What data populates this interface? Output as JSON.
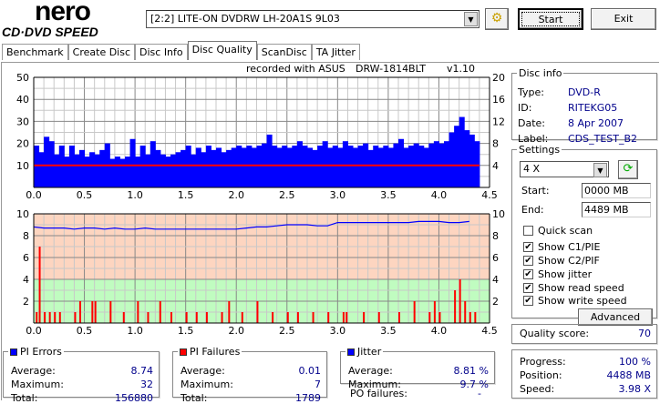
{
  "app": {
    "logo_top": "nero",
    "logo_bottom": "CD·DVD SPEED"
  },
  "toolbar": {
    "drive": "[2:2]  LITE-ON DVDRW LH-20A1S 9L03",
    "start_label": "Start",
    "exit_label": "Exit"
  },
  "tabs": [
    {
      "label": "Benchmark"
    },
    {
      "label": "Create Disc"
    },
    {
      "label": "Disc Info"
    },
    {
      "label": "Disc Quality",
      "active": true
    },
    {
      "label": "ScanDisc"
    },
    {
      "label": "TA Jitter"
    }
  ],
  "chart_header": {
    "recorded": "recorded with ASUS",
    "drive": "DRW-1814BLT",
    "version": "v1.10"
  },
  "disc_info": {
    "title": "Disc info",
    "type_label": "Type:",
    "type": "DVD-R",
    "id_label": "ID:",
    "id": "RITEKG05",
    "date_label": "Date:",
    "date": "8 Apr 2007",
    "label_label": "Label:",
    "label": "CDS_TEST_B2"
  },
  "settings": {
    "title": "Settings",
    "speed": "4 X",
    "start_label": "Start:",
    "start": "0000 MB",
    "end_label": "End:",
    "end": "4489 MB",
    "checkboxes": [
      {
        "label": "Quick scan",
        "checked": false
      },
      {
        "label": "Show C1/PIE",
        "checked": true
      },
      {
        "label": "Show C2/PIF",
        "checked": true
      },
      {
        "label": "Show jitter",
        "checked": true
      },
      {
        "label": "Show read speed",
        "checked": true
      },
      {
        "label": "Show write speed",
        "checked": true
      }
    ],
    "advanced_label": "Advanced"
  },
  "quality": {
    "label": "Quality score:",
    "value": "70"
  },
  "pi_errors": {
    "title": "PI Errors",
    "color": "#0000ff",
    "avg_label": "Average:",
    "avg": "8.74",
    "max_label": "Maximum:",
    "max": "32",
    "total_label": "Total:",
    "total": "156880"
  },
  "pi_failures": {
    "title": "PI Failures",
    "color": "#ff0000",
    "avg_label": "Average:",
    "avg": "0.01",
    "max_label": "Maximum:",
    "max": "7",
    "total_label": "Total:",
    "total": "1789"
  },
  "jitter": {
    "title": "Jitter",
    "color": "#0000ff",
    "avg_label": "Average:",
    "avg": "8.81 %",
    "max_label": "Maximum:",
    "max": "9.7 %",
    "po_label": "PO failures:",
    "po": "-"
  },
  "progress": {
    "progress_label": "Progress:",
    "progress": "100 %",
    "position_label": "Position:",
    "position": "4488 MB",
    "speed_label": "Speed:",
    "speed": "3.98 X"
  },
  "chart_data": [
    {
      "type": "bar",
      "xlim": [
        0,
        4.5
      ],
      "ylim": [
        0,
        50
      ],
      "y2lim": [
        0,
        20
      ],
      "grid": true,
      "xticks": [
        "0.0",
        "0.5",
        "1.0",
        "1.5",
        "2.0",
        "2.5",
        "3.0",
        "3.5",
        "4.0",
        "4.5"
      ],
      "yticks": [
        "10",
        "20",
        "30",
        "40",
        "50"
      ],
      "y2ticks": [
        "4",
        "8",
        "12",
        "16",
        "20"
      ],
      "pie_x_step": 0.05,
      "pie": [
        19,
        16,
        23,
        21,
        15,
        19,
        14,
        19,
        15,
        17,
        14,
        16,
        15,
        17,
        20,
        13,
        14,
        13,
        14,
        22,
        14,
        19,
        15,
        21,
        17,
        15,
        14,
        15,
        16,
        17,
        19,
        15,
        18,
        16,
        19,
        17,
        18,
        16,
        17,
        18,
        19,
        18,
        19,
        18,
        19,
        20,
        24,
        19,
        18,
        19,
        18,
        19,
        21,
        19,
        18,
        17,
        19,
        21,
        18,
        19,
        18,
        21,
        19,
        18,
        19,
        20,
        17,
        19,
        18,
        19,
        18,
        20,
        22,
        18,
        19,
        20,
        19,
        18,
        20,
        21,
        20,
        21,
        25,
        28,
        32,
        26,
        24,
        21
      ],
      "pie_colors": "#0000ff",
      "read_speed_x": 4.0,
      "read_speed_color": "#ff0000"
    },
    {
      "type": "bar",
      "xlim": [
        0,
        4.5
      ],
      "ylim": [
        0,
        10
      ],
      "y2lim": [
        0,
        10
      ],
      "grid": true,
      "xticks": [
        "0.0",
        "0.5",
        "1.0",
        "1.5",
        "2.0",
        "2.5",
        "3.0",
        "3.5",
        "4.0",
        "4.5"
      ],
      "yticks": [
        "2",
        "4",
        "6",
        "8",
        "10"
      ],
      "y2ticks": [
        "2",
        "4",
        "6",
        "8",
        "10"
      ],
      "pif": [
        [
          0.02,
          1
        ],
        [
          0.05,
          7
        ],
        [
          0.1,
          1
        ],
        [
          0.15,
          1
        ],
        [
          0.2,
          1
        ],
        [
          0.25,
          1
        ],
        [
          0.4,
          1
        ],
        [
          0.45,
          2
        ],
        [
          0.57,
          2
        ],
        [
          0.6,
          2
        ],
        [
          0.75,
          2
        ],
        [
          0.88,
          1
        ],
        [
          1.02,
          2
        ],
        [
          1.12,
          1
        ],
        [
          1.24,
          2
        ],
        [
          1.35,
          1
        ],
        [
          1.5,
          1
        ],
        [
          1.6,
          1
        ],
        [
          1.7,
          1
        ],
        [
          1.85,
          1
        ],
        [
          1.92,
          2
        ],
        [
          2.05,
          1
        ],
        [
          2.2,
          2
        ],
        [
          2.35,
          1
        ],
        [
          2.5,
          1
        ],
        [
          2.6,
          1
        ],
        [
          2.75,
          1
        ],
        [
          2.9,
          1
        ],
        [
          3.05,
          1
        ],
        [
          3.08,
          1
        ],
        [
          3.25,
          1
        ],
        [
          3.4,
          1
        ],
        [
          3.6,
          1
        ],
        [
          3.75,
          2
        ],
        [
          3.9,
          1
        ],
        [
          3.95,
          2
        ],
        [
          4.0,
          1
        ],
        [
          4.15,
          3
        ],
        [
          4.2,
          4
        ],
        [
          4.25,
          2
        ],
        [
          4.3,
          1
        ],
        [
          4.35,
          1
        ]
      ],
      "jitter_x_step": 0.1,
      "jitter": [
        8.8,
        8.7,
        8.7,
        8.7,
        8.6,
        8.7,
        8.7,
        8.6,
        8.7,
        8.6,
        8.6,
        8.7,
        8.6,
        8.6,
        8.6,
        8.6,
        8.6,
        8.6,
        8.6,
        8.6,
        8.6,
        8.7,
        8.8,
        8.8,
        8.9,
        9.0,
        9.0,
        9.0,
        8.9,
        8.9,
        9.2,
        9.2,
        9.2,
        9.2,
        9.2,
        9.2,
        9.2,
        9.2,
        9.3,
        9.3,
        9.3,
        9.2,
        9.2,
        9.3
      ],
      "bands": {
        "good_below": 4,
        "good_color": "#c0fcc0",
        "bad_color": "#fdd5c0"
      }
    }
  ]
}
